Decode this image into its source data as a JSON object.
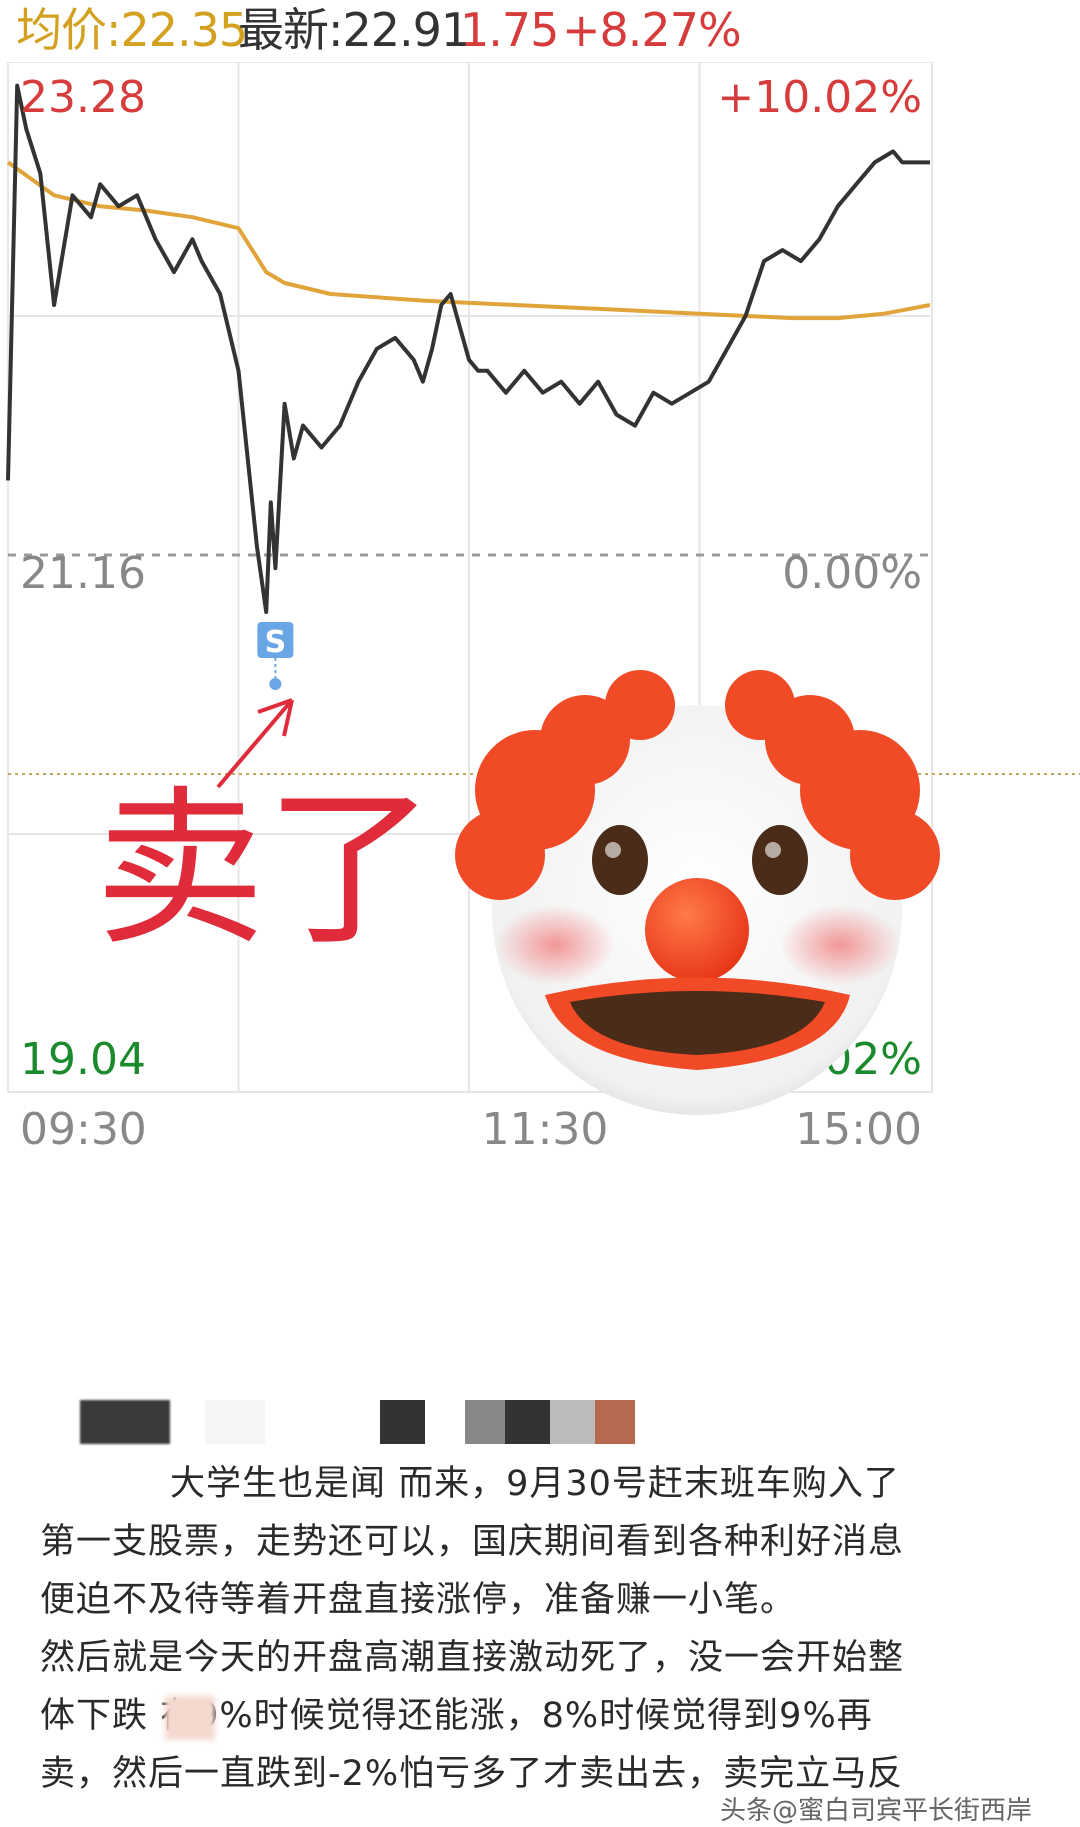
{
  "header": {
    "avg_label": "均价:22.35",
    "latest_label": "最新:22.91",
    "change": "1.75",
    "change_pct": "+8.27%"
  },
  "chart_data": {
    "type": "line",
    "title": "",
    "ylim": [
      19.04,
      23.28
    ],
    "y_left_ticks": [
      "23.28",
      "21.16",
      "19.04"
    ],
    "y_right_ticks": [
      "+10.02%",
      "0.00%",
      "-10.02%"
    ],
    "x_ticks": [
      "09:30",
      "11:30",
      "15:00"
    ],
    "grid": true,
    "series": [
      {
        "color": "#333333",
        "x": [
          0,
          0.01,
          0.02,
          0.035,
          0.05,
          0.07,
          0.09,
          0.1,
          0.12,
          0.14,
          0.16,
          0.18,
          0.2,
          0.21,
          0.23,
          0.25,
          0.26,
          0.27,
          0.28,
          0.285,
          0.29,
          0.3,
          0.31,
          0.32,
          0.33,
          0.34,
          0.36,
          0.38,
          0.4,
          0.42,
          0.44,
          0.45,
          0.46,
          0.47,
          0.48,
          0.49,
          0.5,
          0.51,
          0.52,
          0.54,
          0.56,
          0.58,
          0.6,
          0.62,
          0.64,
          0.66,
          0.68,
          0.7,
          0.72,
          0.74,
          0.76,
          0.78,
          0.8,
          0.82,
          0.84,
          0.86,
          0.88,
          0.9,
          0.92,
          0.94,
          0.96,
          0.97,
          0.98,
          1.0
        ],
        "values": [
          21.5,
          23.3,
          23.1,
          22.9,
          22.3,
          22.8,
          22.7,
          22.85,
          22.75,
          22.8,
          22.6,
          22.45,
          22.6,
          22.5,
          22.35,
          22.0,
          21.6,
          21.2,
          20.9,
          21.4,
          21.1,
          21.85,
          21.6,
          21.75,
          21.7,
          21.65,
          21.75,
          21.95,
          22.1,
          22.15,
          22.05,
          21.95,
          22.1,
          22.3,
          22.35,
          22.2,
          22.05,
          22.0,
          22.0,
          21.9,
          22.0,
          21.9,
          21.95,
          21.85,
          21.95,
          21.8,
          21.75,
          21.9,
          21.85,
          21.9,
          21.95,
          22.1,
          22.25,
          22.5,
          22.55,
          22.5,
          22.6,
          22.75,
          22.85,
          22.95,
          23.0,
          22.95,
          22.95,
          22.95
        ],
        "name": ""
      },
      {
        "color": "#e0a43a",
        "x": [
          0,
          0.05,
          0.1,
          0.15,
          0.2,
          0.25,
          0.28,
          0.3,
          0.35,
          0.45,
          0.55,
          0.65,
          0.75,
          0.85,
          0.9,
          0.95,
          1.0
        ],
        "values": [
          22.95,
          22.8,
          22.75,
          22.73,
          22.7,
          22.65,
          22.45,
          22.4,
          22.35,
          22.32,
          22.3,
          22.28,
          22.26,
          22.24,
          22.24,
          22.26,
          22.3
        ],
        "name": ""
      }
    ],
    "markers": [
      {
        "label": "S",
        "x": 0.29,
        "value": 20.95,
        "color": "#6aa6e6"
      }
    ],
    "annotation": {
      "text": "卖了",
      "color": "#e02b3a"
    }
  },
  "colors": {
    "up": "#d63c3c",
    "down": "#1a8a2c",
    "avg": "#d4a020",
    "grid": "#e6e6e6",
    "axis_label": "#888888"
  },
  "post": {
    "lines": [
      "大学生也是闻 而来，9月30号赶末班车购入了",
      "第一支股票，走势还可以，国庆期间看到各种利好消息",
      "便迫不及待等着开盘直接涨停，准备赚一小笔。",
      "然后就是今天的开盘高潮直接激动死了，没一会开始整",
      "体下跌 在9%时候觉得还能涨，8%时候觉得到9%再",
      "卖，然后一直跌到-2%怕亏多了才卖出去，卖完立马反"
    ]
  },
  "watermark": "头条@蜜白司宾平长街西岸",
  "emoji": {
    "icon": "clown-face-icon"
  }
}
